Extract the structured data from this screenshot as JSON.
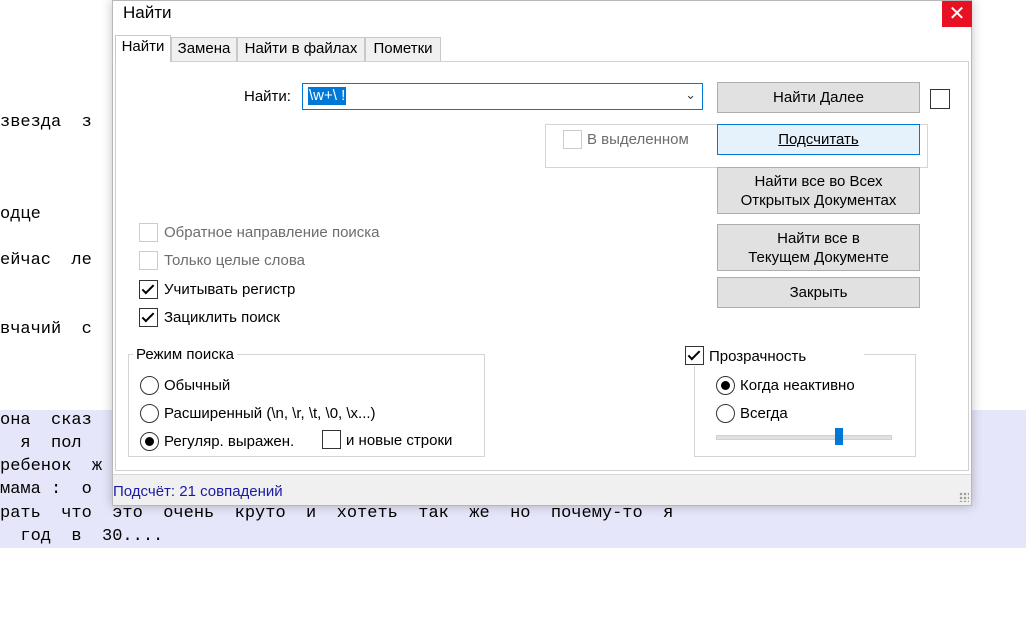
{
  "editor": {
    "lines": [
      "звезда  з",
      "одце",
      "ейчас  ле",
      "вчачий  с",
      "она  сказ",
      "  я  пол",
      "ребенок  ж",
      "мама :  о",
      "рать  что  это  очень  круто  и  хотеть  так  же  но  почему-то  я",
      "  год  в  30...."
    ]
  },
  "dialog": {
    "title": "Найти",
    "close_glyph": "✕",
    "tabs": [
      {
        "label": "Найти",
        "active": true
      },
      {
        "label": "Замена",
        "active": false
      },
      {
        "label": "Найти в файлах",
        "active": false
      },
      {
        "label": "Пометки",
        "active": false
      }
    ],
    "find_label": "Найти:",
    "find_value": "\\w+\\ !",
    "in_selection_label": "В выделенном",
    "buttons": {
      "find_next": "Найти Далее",
      "count": "Подсчитать",
      "find_all_open_line1": "Найти все во Всех",
      "find_all_open_line2": "Открытых Документах",
      "find_all_current_line1": "Найти все в",
      "find_all_current_line2": "Текущем Документе",
      "close": "Закрыть"
    },
    "options": [
      {
        "label": "Обратное направление поиска",
        "checked": false,
        "disabled": true
      },
      {
        "label": "Только целые слова",
        "checked": false,
        "disabled": true
      },
      {
        "label": "Учитывать регистр",
        "checked": true,
        "disabled": false
      },
      {
        "label": "Зациклить поиск",
        "checked": true,
        "disabled": false
      }
    ],
    "search_mode": {
      "legend": "Режим поиска",
      "options": [
        {
          "label": "Обычный",
          "selected": false
        },
        {
          "label": "Расширенный (\\n, \\r, \\t, \\0, \\x...)",
          "selected": false
        },
        {
          "label": "Регуляр. выражен.",
          "selected": true
        }
      ],
      "newline_label": "и новые строки",
      "newline_checked": false
    },
    "transparency": {
      "label": "Прозрачность",
      "checked": true,
      "options": [
        {
          "label": "Когда неактивно",
          "selected": true
        },
        {
          "label": "Всегда",
          "selected": false
        }
      ],
      "slider_value": 0.7
    },
    "status": "Подсчёт: 21 совпадений"
  },
  "colors": {
    "accent": "#0078d7",
    "close_red": "#e81123",
    "status_text": "#1a1aa6",
    "selection_band": "#e6e6fa"
  }
}
